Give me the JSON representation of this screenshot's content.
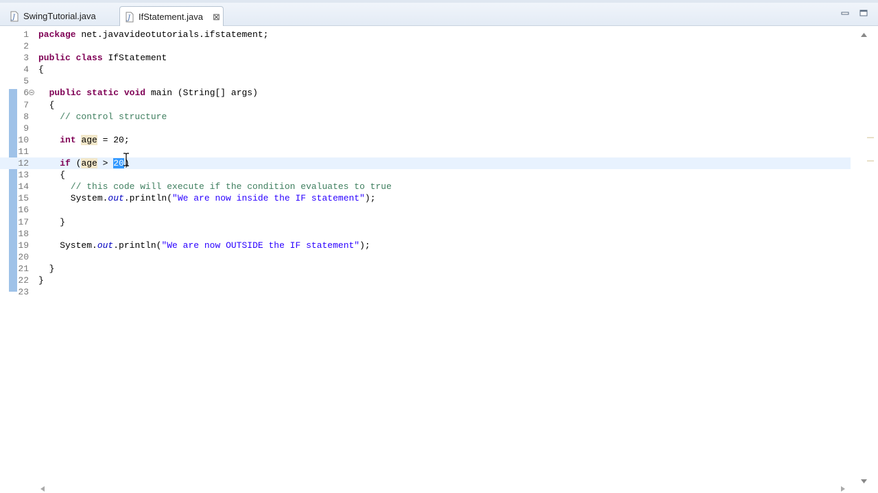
{
  "tabs": [
    {
      "label": "SwingTutorial.java",
      "active": false,
      "icon": "java-file-icon"
    },
    {
      "label": "IfStatement.java",
      "active": true,
      "icon": "java-file-icon",
      "close_icon": "close-icon"
    }
  ],
  "window_controls": [
    "minimize-icon",
    "maximize-icon"
  ],
  "editor": {
    "current_line": 12,
    "lines": [
      {
        "n": "1",
        "text": "package net.javavideotutorials.ifstatement;"
      },
      {
        "n": "2",
        "text": ""
      },
      {
        "n": "3",
        "text": "public class IfStatement"
      },
      {
        "n": "4",
        "text": "{"
      },
      {
        "n": "5",
        "text": ""
      },
      {
        "n": "6",
        "text": "  public static void main (String[] args)"
      },
      {
        "n": "7",
        "text": "  {"
      },
      {
        "n": "8",
        "text": "    // control structure"
      },
      {
        "n": "9",
        "text": ""
      },
      {
        "n": "10",
        "text": "    int age = 20;"
      },
      {
        "n": "11",
        "text": ""
      },
      {
        "n": "12",
        "text": "    if (age > 20)"
      },
      {
        "n": "13",
        "text": "    {"
      },
      {
        "n": "14",
        "text": "      // this code will execute if the condition evaluates to true"
      },
      {
        "n": "15",
        "text": "      System.out.println(\"We are now inside the IF statement\");"
      },
      {
        "n": "16",
        "text": ""
      },
      {
        "n": "17",
        "text": "    }"
      },
      {
        "n": "18",
        "text": ""
      },
      {
        "n": "19",
        "text": "    System.out.println(\"We are now OUTSIDE the IF statement\");"
      },
      {
        "n": "20",
        "text": ""
      },
      {
        "n": "21",
        "text": "  }"
      },
      {
        "n": "22",
        "text": "}"
      },
      {
        "n": "23",
        "text": ""
      }
    ]
  },
  "colors": {
    "keyword": "#7f0055",
    "comment": "#3f7f5f",
    "string": "#2a00ff",
    "field": "#0000c0",
    "selection": "#3399ff",
    "current_line": "#e8f2fe",
    "change_marker": "#9fc2e8"
  }
}
